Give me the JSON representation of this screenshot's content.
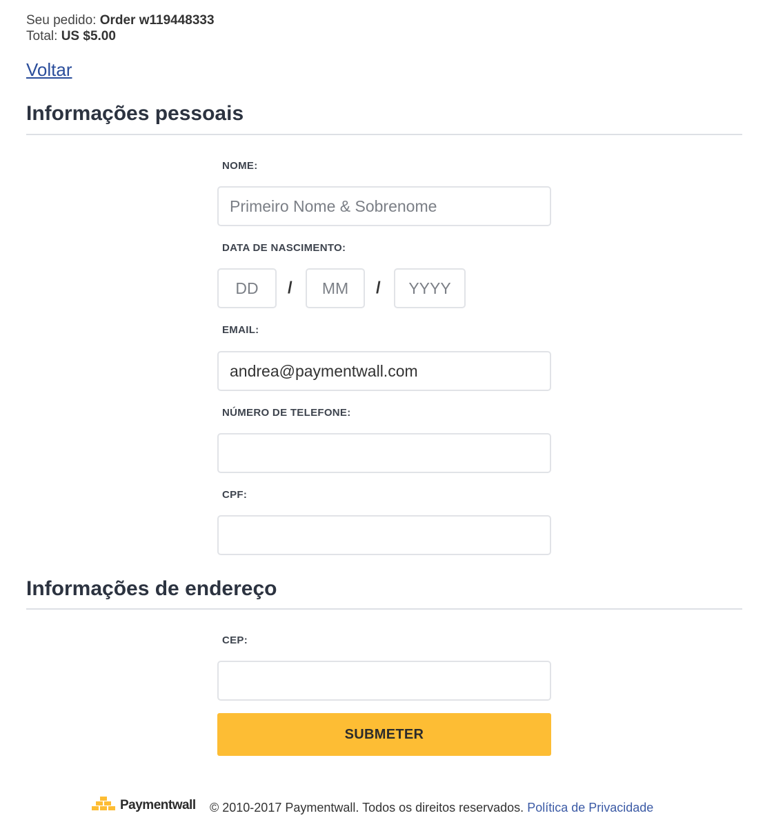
{
  "order": {
    "order_label": "Seu pedido:",
    "order_value": "Order w119448333",
    "total_label": "Total:",
    "total_value": "US $5.00"
  },
  "back_link": "Voltar",
  "personal_section": {
    "title": "Informações pessoais",
    "name": {
      "label": "NOME:",
      "placeholder": "Primeiro Nome & Sobrenome",
      "value": ""
    },
    "birthdate": {
      "label": "DATA DE NASCIMENTO:",
      "day_placeholder": "DD",
      "month_placeholder": "MM",
      "year_placeholder": "YYYY",
      "separator": "/"
    },
    "email": {
      "label": "EMAIL:",
      "value": "andrea@paymentwall.com"
    },
    "phone": {
      "label": "NÚMERO DE TELEFONE:",
      "value": ""
    },
    "cpf": {
      "label": "CPF:",
      "value": ""
    }
  },
  "address_section": {
    "title": "Informações de endereço",
    "cep": {
      "label": "CEP:",
      "value": ""
    }
  },
  "submit_label": "SUBMETER",
  "footer": {
    "brand": "Paymentwall",
    "logo_icon": "paymentwall-logo-icon",
    "copyright": "© 2010-2017 Paymentwall. Todos os direitos reservados.",
    "privacy_link": "Política de Privacidade"
  },
  "colors": {
    "accent": "#fdbd34",
    "link": "#2a4d9b",
    "heading": "#2c3340"
  }
}
